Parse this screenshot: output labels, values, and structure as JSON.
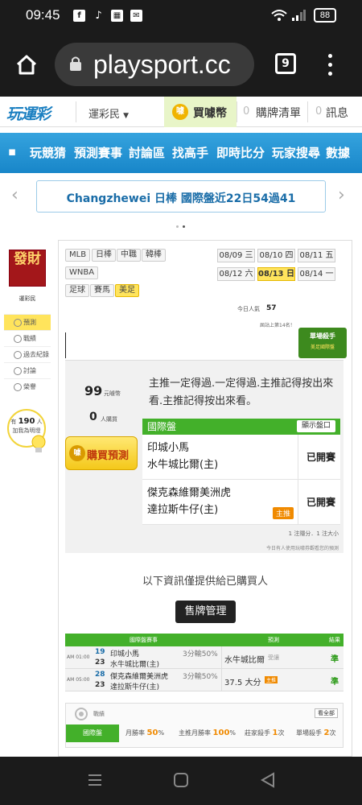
{
  "status_bar": {
    "time": "09:45",
    "battery": "88",
    "icons": [
      "facebook-icon",
      "tiktok-icon",
      "news-icon",
      "message-icon",
      "wifi-icon",
      "signal-icon",
      "battery-icon"
    ]
  },
  "browser": {
    "url": "playsport.cc",
    "tab_count": "9"
  },
  "header": {
    "logo": "玩運彩",
    "user_menu": "運彩民",
    "buy_coin": "買噱幣",
    "coin_glyph": "噱",
    "cart_count": "0",
    "cart_label": "購牌清單",
    "msg_count": "0",
    "msg_label": "訊息"
  },
  "nav": {
    "items": [
      "玩競猜",
      "預測賽事",
      "討論區",
      "找高手",
      "即時比分",
      "玩家搜尋",
      "數據"
    ]
  },
  "marquee": {
    "user": "Changzhewei",
    "text": "日棒 國際盤近22日54過41"
  },
  "sidebar": {
    "avatar_text": "發財",
    "username": "運彩民",
    "items": [
      "預測",
      "戰績",
      "過去紀錄",
      "討論",
      "榮譽"
    ],
    "fans_prefix": "有",
    "fans_count": "190",
    "fans_unit": "人",
    "fans_suffix": "加我為明燈"
  },
  "leagues": {
    "row1": [
      "MLB",
      "日棒",
      "中職",
      "韓棒"
    ],
    "row2": [
      "WNBA"
    ],
    "row3": [
      "足球",
      "賽馬",
      "美足"
    ]
  },
  "dates": {
    "row1": [
      "08/09 三",
      "08/10 四",
      "08/11 五"
    ],
    "row2": [
      "08/12 六",
      "08/13 日",
      "08/14 一"
    ]
  },
  "popularity": {
    "today_label": "今日人氣",
    "today_value": "57",
    "rank_text": "屆站上第14名！"
  },
  "badge": {
    "title": "單場殺手",
    "subtitle": "美足國際盤"
  },
  "prediction": {
    "price": "99",
    "price_unit": "元噱幣",
    "buyers": "0",
    "buyers_unit": "人購買",
    "buy_button": "購買預測",
    "message": "主推一定得過.一定得過.主推記得按出來看.主推記得按出來看。",
    "market_label": "國際盤",
    "show_market_button": "顯示盤口",
    "games": [
      {
        "team1": "印城小馬",
        "team2": "水牛城比爾(主)",
        "status": "已開賽",
        "tag": ""
      },
      {
        "team1": "傑克森維爾美洲虎",
        "team2": "達拉斯牛仔(主)",
        "status": "已開賽",
        "tag": "主推"
      }
    ],
    "note_count": "1 注隱分．1 注大小",
    "note_buyers": "今日有人使用玩噱券觀看您的預測"
  },
  "buyers_only_notice": "以下資訊僅提供給已購買人",
  "sell_manage_button": "售牌管理",
  "results": {
    "headers": [
      "國際盤賽事",
      "預測",
      "結果"
    ],
    "rows": [
      {
        "time": "AM 01:00",
        "no1": "19",
        "team1": "印城小馬",
        "no2": "23",
        "team2": "水牛城比爾(主)",
        "line": "3分輸50%",
        "pick": "水牛城比爾",
        "pick_note": "受讓",
        "result": "準"
      },
      {
        "time": "AM 05:00",
        "no1": "28",
        "team1": "傑克森維爾美洲虎",
        "no2": "23",
        "team2": "達拉斯牛仔(主)",
        "line": "3分輸50%",
        "pick": "37.5 大分",
        "pick_note": "主推",
        "result": "準"
      }
    ]
  },
  "record": {
    "title": "戰績",
    "view_all": "看全部",
    "label": "國際盤",
    "hit_rate_label": "月勝率",
    "hit_rate": "50",
    "main_rate_label": "主推月勝率",
    "main_rate": "100",
    "killer_label": "莊家殺手",
    "killer_count": "1",
    "single_label": "單場殺手",
    "single_count": "2",
    "percent": "%",
    "times": "次"
  },
  "colors": {
    "accent_blue": "#1886c9",
    "accent_green": "#43b02a",
    "highlight_yellow": "#ffe45c",
    "result_green": "#2e9b1a"
  }
}
